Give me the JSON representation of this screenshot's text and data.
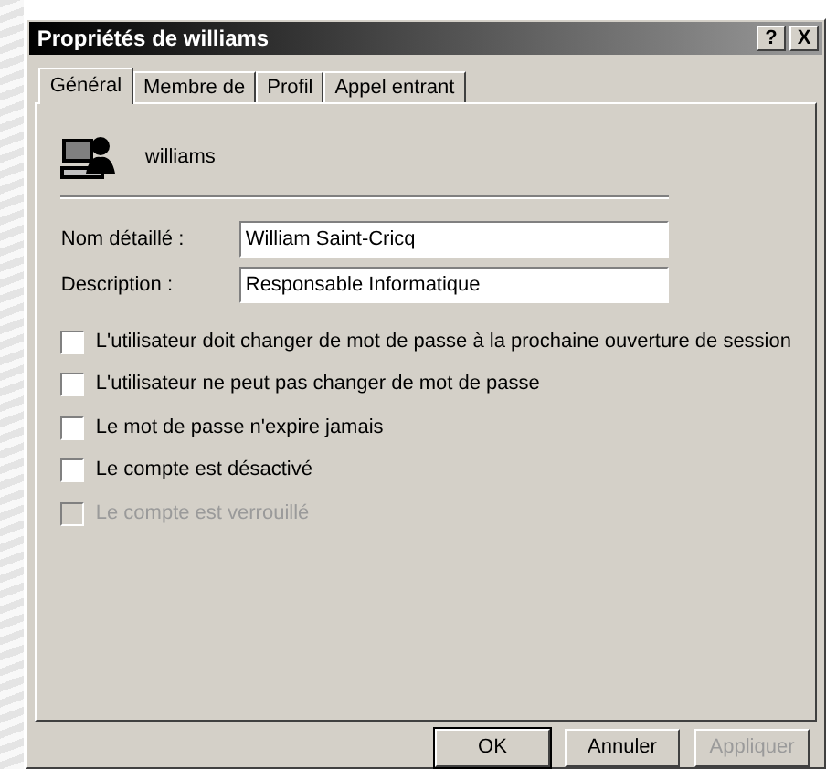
{
  "window": {
    "title": "Propriétés de williams",
    "help_button": "?",
    "close_button": "X"
  },
  "tabs": [
    {
      "label": "Général",
      "selected": true
    },
    {
      "label": "Membre de",
      "selected": false
    },
    {
      "label": "Profil",
      "selected": false
    },
    {
      "label": "Appel entrant",
      "selected": false
    }
  ],
  "user": {
    "name": "williams"
  },
  "fields": [
    {
      "label": "Nom détaillé :",
      "value": "William Saint-Cricq"
    },
    {
      "label": "Description :",
      "value": "Responsable Informatique"
    }
  ],
  "options": [
    {
      "label": "L'utilisateur doit changer de mot de passe à la prochaine ouverture de session",
      "checked": false,
      "disabled": false
    },
    {
      "label": "L'utilisateur ne peut pas changer de mot de passe",
      "checked": false,
      "disabled": false
    },
    {
      "label": "Le mot de passe n'expire jamais",
      "checked": false,
      "disabled": false
    },
    {
      "label": "Le compte est désactivé",
      "checked": false,
      "disabled": false
    },
    {
      "label": "Le compte est verrouillé",
      "checked": false,
      "disabled": true
    }
  ],
  "buttons": [
    {
      "label": "OK",
      "disabled": false,
      "default": true
    },
    {
      "label": "Annuler",
      "disabled": false,
      "default": false
    },
    {
      "label": "Appliquer",
      "disabled": true,
      "default": false
    }
  ]
}
